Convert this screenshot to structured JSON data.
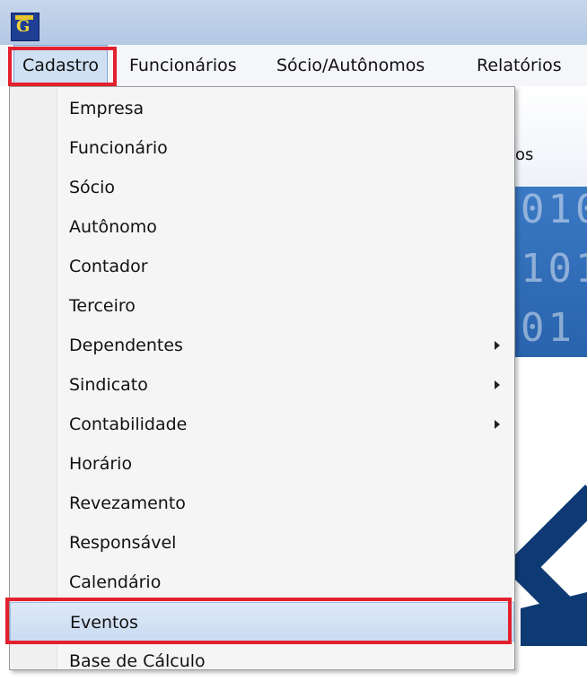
{
  "window": {
    "icon": "app-logo-icon",
    "icon_letter": "G"
  },
  "menubar": {
    "items": [
      "Cadastro",
      "Funcionários",
      "Sócio/Autônomos",
      "Relatórios"
    ],
    "active_index": 0
  },
  "background": {
    "toolbar_partial_label": "os",
    "banner_lines": [
      "010",
      "101",
      "01"
    ]
  },
  "dropdown": {
    "items": [
      {
        "label": "Empresa",
        "submenu": false
      },
      {
        "label": "Funcionário",
        "submenu": false
      },
      {
        "label": "Sócio",
        "submenu": false
      },
      {
        "label": "Autônomo",
        "submenu": false
      },
      {
        "label": "Contador",
        "submenu": false
      },
      {
        "label": "Terceiro",
        "submenu": false
      },
      {
        "label": "Dependentes",
        "submenu": true
      },
      {
        "label": "Sindicato",
        "submenu": true
      },
      {
        "label": "Contabilidade",
        "submenu": true
      },
      {
        "label": "Horário",
        "submenu": false
      },
      {
        "label": "Revezamento",
        "submenu": false
      },
      {
        "label": "Responsável",
        "submenu": false
      },
      {
        "label": "Calendário",
        "submenu": false
      },
      {
        "label": "Eventos",
        "submenu": false
      },
      {
        "label": "Base de Cálculo",
        "submenu": false
      }
    ],
    "selected_index": 13
  },
  "colors": {
    "highlight_box": "#e3212e",
    "accent": "#2963ad"
  }
}
